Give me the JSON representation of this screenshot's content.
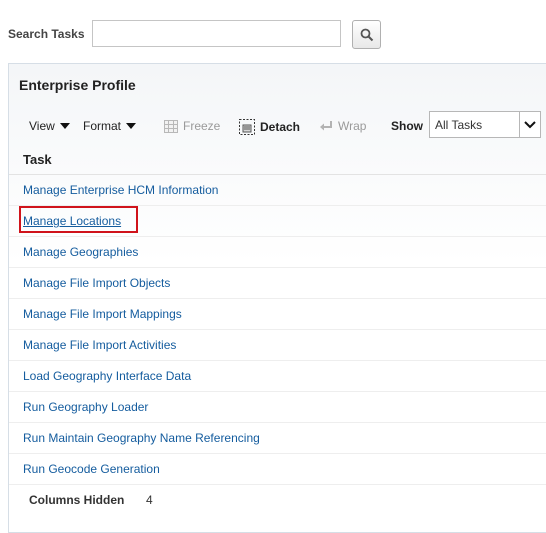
{
  "search": {
    "label": "Search Tasks",
    "value": "",
    "placeholder": ""
  },
  "panel": {
    "title": "Enterprise Profile"
  },
  "toolbar": {
    "view_label": "View",
    "format_label": "Format",
    "freeze_label": "Freeze",
    "detach_label": "Detach",
    "wrap_label": "Wrap",
    "show_label": "Show",
    "show_value": "All Tasks"
  },
  "table": {
    "column_header": "Task",
    "rows": [
      "Manage Enterprise HCM Information",
      "Manage Locations",
      "Manage Geographies",
      "Manage File Import Objects",
      "Manage File Import Mappings",
      "Manage File Import Activities",
      "Load Geography Interface Data",
      "Run Geography Loader",
      "Run Maintain Geography Name Referencing",
      "Run Geocode Generation"
    ],
    "selected_index": 1
  },
  "footer": {
    "columns_hidden_label": "Columns Hidden",
    "columns_hidden_count": "4"
  },
  "colors": {
    "link": "#145c9e",
    "highlight": "#d0131b",
    "disabled": "#9a9a9a"
  },
  "icons": {
    "search": "search-icon",
    "freeze": "freeze-icon",
    "detach": "detach-icon",
    "wrap": "wrap-icon",
    "dropdown": "chevron-down-icon"
  }
}
